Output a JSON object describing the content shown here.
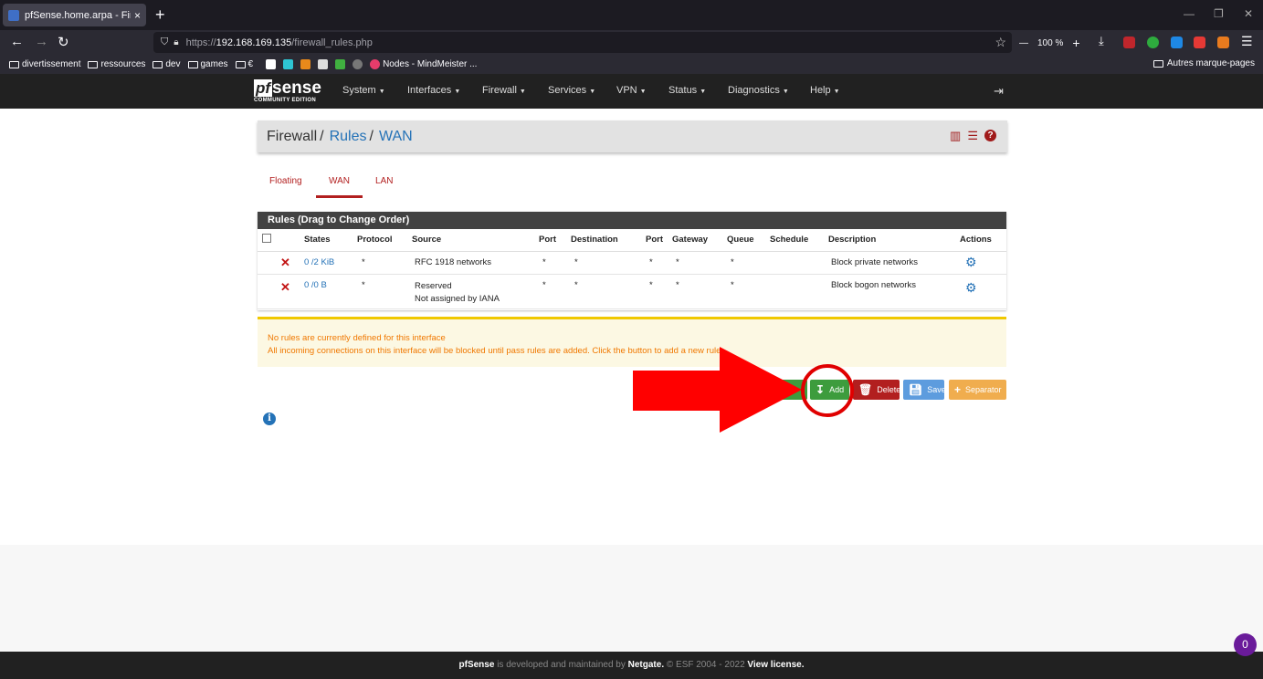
{
  "browser": {
    "tab_title": "pfSense.home.arpa - Firewall: R",
    "tab_close": "×",
    "new_tab": "+",
    "url_prefix": "https://",
    "url_host": "192.168.169.135",
    "url_path": "/firewall_rules.php",
    "zoom": "100 %",
    "bookmarks": [
      "divertissement",
      "ressources",
      "dev",
      "games",
      "€",
      "Nodes - MindMeister ..."
    ],
    "bookmarks_right": "Autres marque-pages"
  },
  "pf_header": {
    "logo_pf": "pf",
    "logo_sense": "sense",
    "logo_sub": "COMMUNITY EDITION",
    "menu": [
      "System",
      "Interfaces",
      "Firewall",
      "Services",
      "VPN",
      "Status",
      "Diagnostics",
      "Help"
    ]
  },
  "breadcrumb": {
    "root": "Firewall",
    "sep": "/",
    "level2": "Rules",
    "level3": "WAN"
  },
  "tabs": [
    "Floating",
    "WAN",
    "LAN"
  ],
  "active_tab": "WAN",
  "rules_panel": {
    "title": "Rules (Drag to Change Order)",
    "columns": [
      "States",
      "Protocol",
      "Source",
      "Port",
      "Destination",
      "Port",
      "Gateway",
      "Queue",
      "Schedule",
      "Description",
      "Actions"
    ],
    "rows": [
      {
        "states": "0 /2 KiB",
        "protocol": "*",
        "source": "RFC 1918 networks",
        "source2": "",
        "port": "*",
        "destination": "*",
        "dport": "*",
        "gateway": "*",
        "queue": "*",
        "schedule": "",
        "description": "Block private networks"
      },
      {
        "states": "0 /0 B",
        "protocol": "*",
        "source": "Reserved",
        "source2": "Not assigned by IANA",
        "port": "*",
        "destination": "*",
        "dport": "*",
        "gateway": "*",
        "queue": "*",
        "schedule": "",
        "description": "Block bogon networks"
      }
    ]
  },
  "alert": {
    "line1": "No rules are currently defined for this interface",
    "line2": "All incoming connections on this interface will be blocked until pass rules are added. Click the button to add a new rule."
  },
  "buttons": {
    "add": "Add",
    "delete": "Delete",
    "save": "Save",
    "separator": "Separator"
  },
  "footer": {
    "brand": "pfSense",
    "text1": " is developed and maintained by ",
    "company": "Netgate.",
    "text2": " © ESF 2004 - 2022 ",
    "license": "View license."
  },
  "badge": "0",
  "colors": {
    "pf_red": "#b21f1f",
    "link_blue": "#2472b7",
    "add_green": "#3d9c3d",
    "delete_red": "#b21f1f",
    "save_blue": "#5d9cde",
    "separator_orange": "#f0ad4e",
    "annotation_red": "#ff0000"
  }
}
